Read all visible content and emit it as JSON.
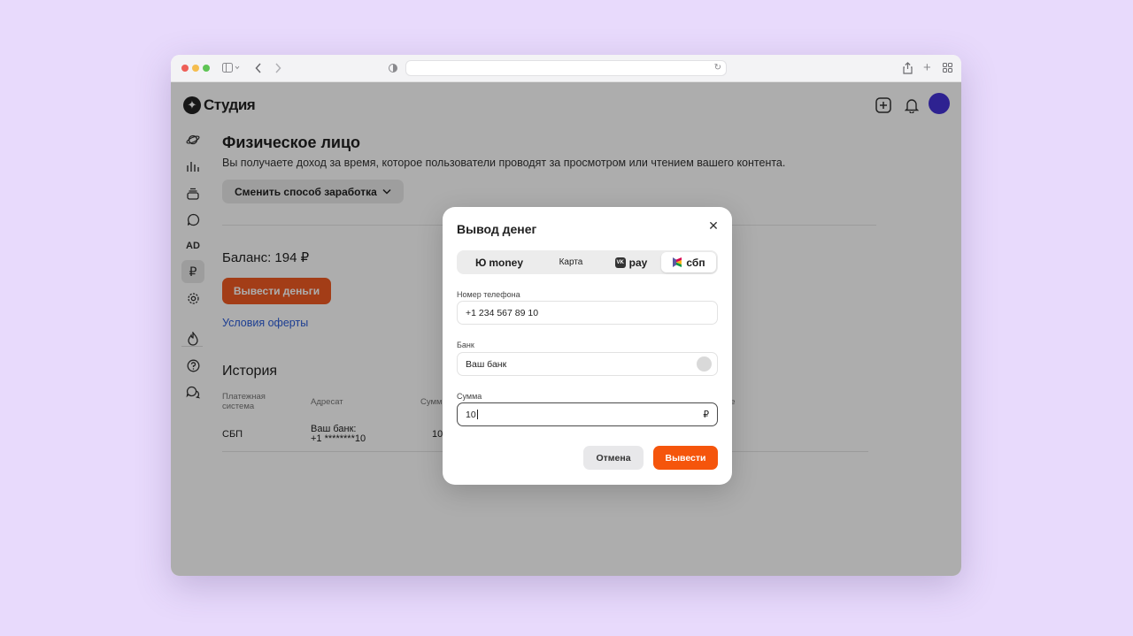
{
  "app": {
    "logo_text": "Студия"
  },
  "page": {
    "title": "Физическое лицо",
    "subtitle": "Вы получаете доход за время, которое пользователи проводят за просмотром или чтением вашего контента.",
    "change_method_label": "Сменить способ заработка",
    "balance": "Баланс: 194 ₽",
    "withdraw_label": "Вывести деньги",
    "terms_link": "Условия оферты",
    "history_title": "История",
    "history_table": {
      "headers": [
        "Платежная система",
        "Адресат",
        "Сумм",
        "ие"
      ],
      "rows": [
        {
          "system": "СБП",
          "recipient_line1": "Ваш банк:",
          "recipient_line2": "+1 ********10",
          "amount": "10"
        }
      ]
    }
  },
  "sidebar": {
    "items": [
      {
        "icon": "planet-icon"
      },
      {
        "icon": "stats-icon"
      },
      {
        "icon": "layers-icon"
      },
      {
        "icon": "comment-icon"
      },
      {
        "icon": "ad-icon",
        "label": "AD"
      },
      {
        "icon": "ruble-icon",
        "label": "₽",
        "active": true
      },
      {
        "icon": "gear-icon"
      },
      {
        "icon": "fire-icon"
      },
      {
        "icon": "help-icon"
      },
      {
        "icon": "chat-icon"
      }
    ]
  },
  "modal": {
    "title": "Вывод денег",
    "tabs": [
      {
        "label": "money",
        "icon": "yoomoney-icon"
      },
      {
        "label": "Карта"
      },
      {
        "label": "pay",
        "icon": "vk-icon"
      },
      {
        "label": "сбп",
        "icon": "sbp-icon",
        "active": true
      }
    ],
    "phone_label": "Номер телефона",
    "phone_value": "+1 234 567 89 10",
    "bank_label": "Банк",
    "bank_value": "Ваш банк",
    "amount_label": "Сумма",
    "amount_value": "10",
    "currency": "₽",
    "cancel_label": "Отмена",
    "submit_label": "Вывести"
  },
  "colors": {
    "accent": "#f05a22",
    "avatar": "#4433d6",
    "link": "#2a5bd7",
    "backdrop": "#e8dafc"
  }
}
